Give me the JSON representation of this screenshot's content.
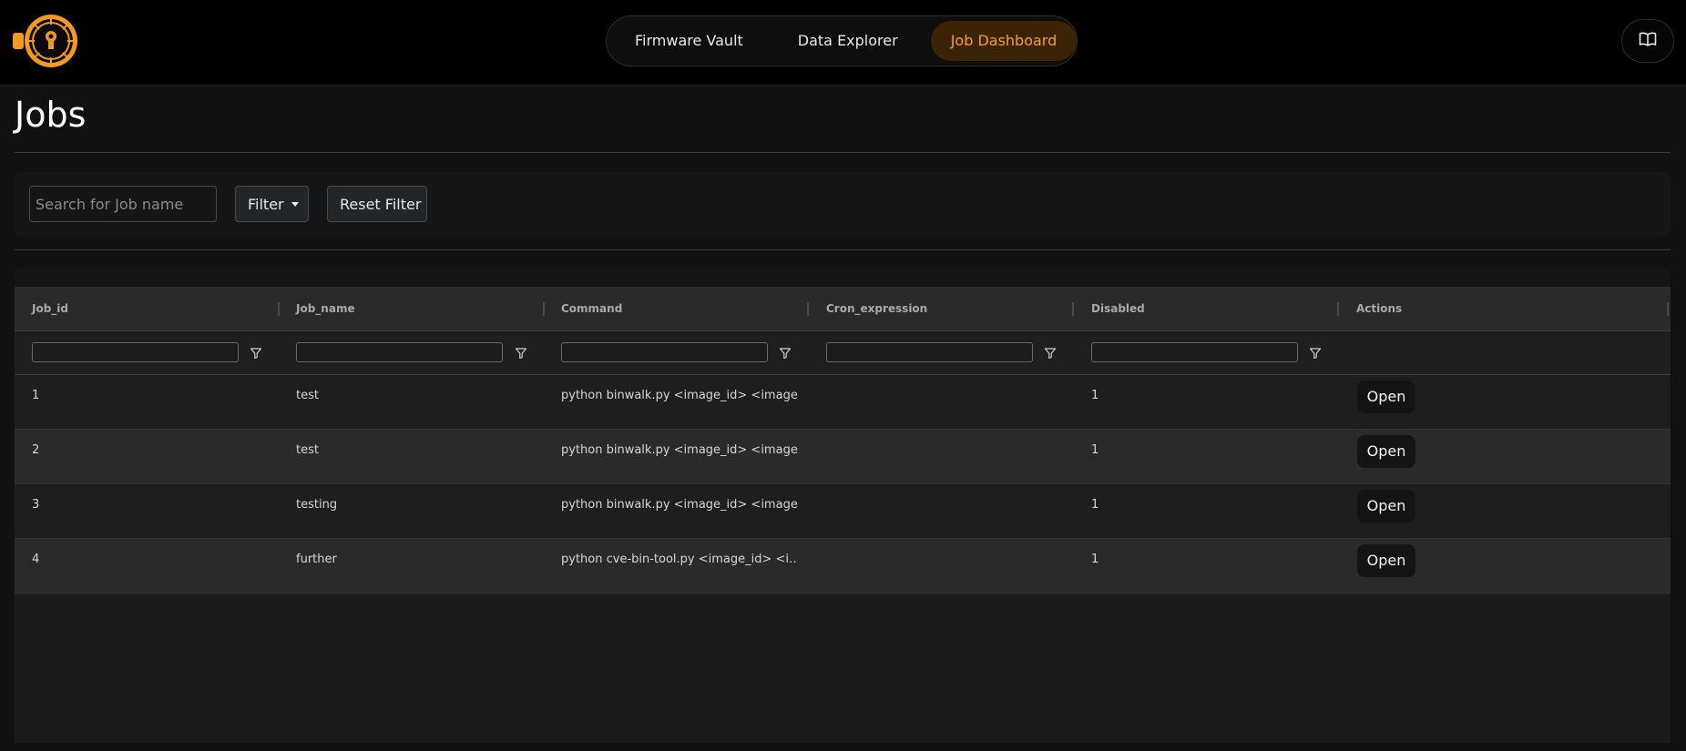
{
  "nav": {
    "items": [
      {
        "label": "Firmware Vault"
      },
      {
        "label": "Data Explorer"
      },
      {
        "label": "Job Dashboard"
      }
    ],
    "active": "Job Dashboard"
  },
  "page": {
    "title": "Jobs"
  },
  "filters": {
    "search_placeholder": "Search for Job name",
    "filter_label": "Filter",
    "reset_label": "Reset Filter"
  },
  "table": {
    "columns": [
      "Job_id",
      "Job_name",
      "Command",
      "Cron_expression",
      "Disabled",
      "Actions"
    ],
    "rows": [
      {
        "job_id": "1",
        "job_name": "test",
        "command": "python binwalk.py <image_id> <image…",
        "cron": "",
        "disabled": "1",
        "action": "Open"
      },
      {
        "job_id": "2",
        "job_name": "test",
        "command": "python binwalk.py <image_id> <image…",
        "cron": "",
        "disabled": "1",
        "action": "Open"
      },
      {
        "job_id": "3",
        "job_name": "testing",
        "command": "python binwalk.py <image_id> <image…",
        "cron": "",
        "disabled": "1",
        "action": "Open"
      },
      {
        "job_id": "4",
        "job_name": "further",
        "command": "python cve-bin-tool.py <image_id> <i…",
        "cron": "",
        "disabled": "1",
        "action": "Open"
      }
    ]
  },
  "colors": {
    "accent": "#f5a020",
    "background": "#111111",
    "topbar": "#000000"
  },
  "icons": {
    "logo": "vault-lock-logo",
    "docs": "book-icon",
    "column_filter": "funnel-icon"
  }
}
